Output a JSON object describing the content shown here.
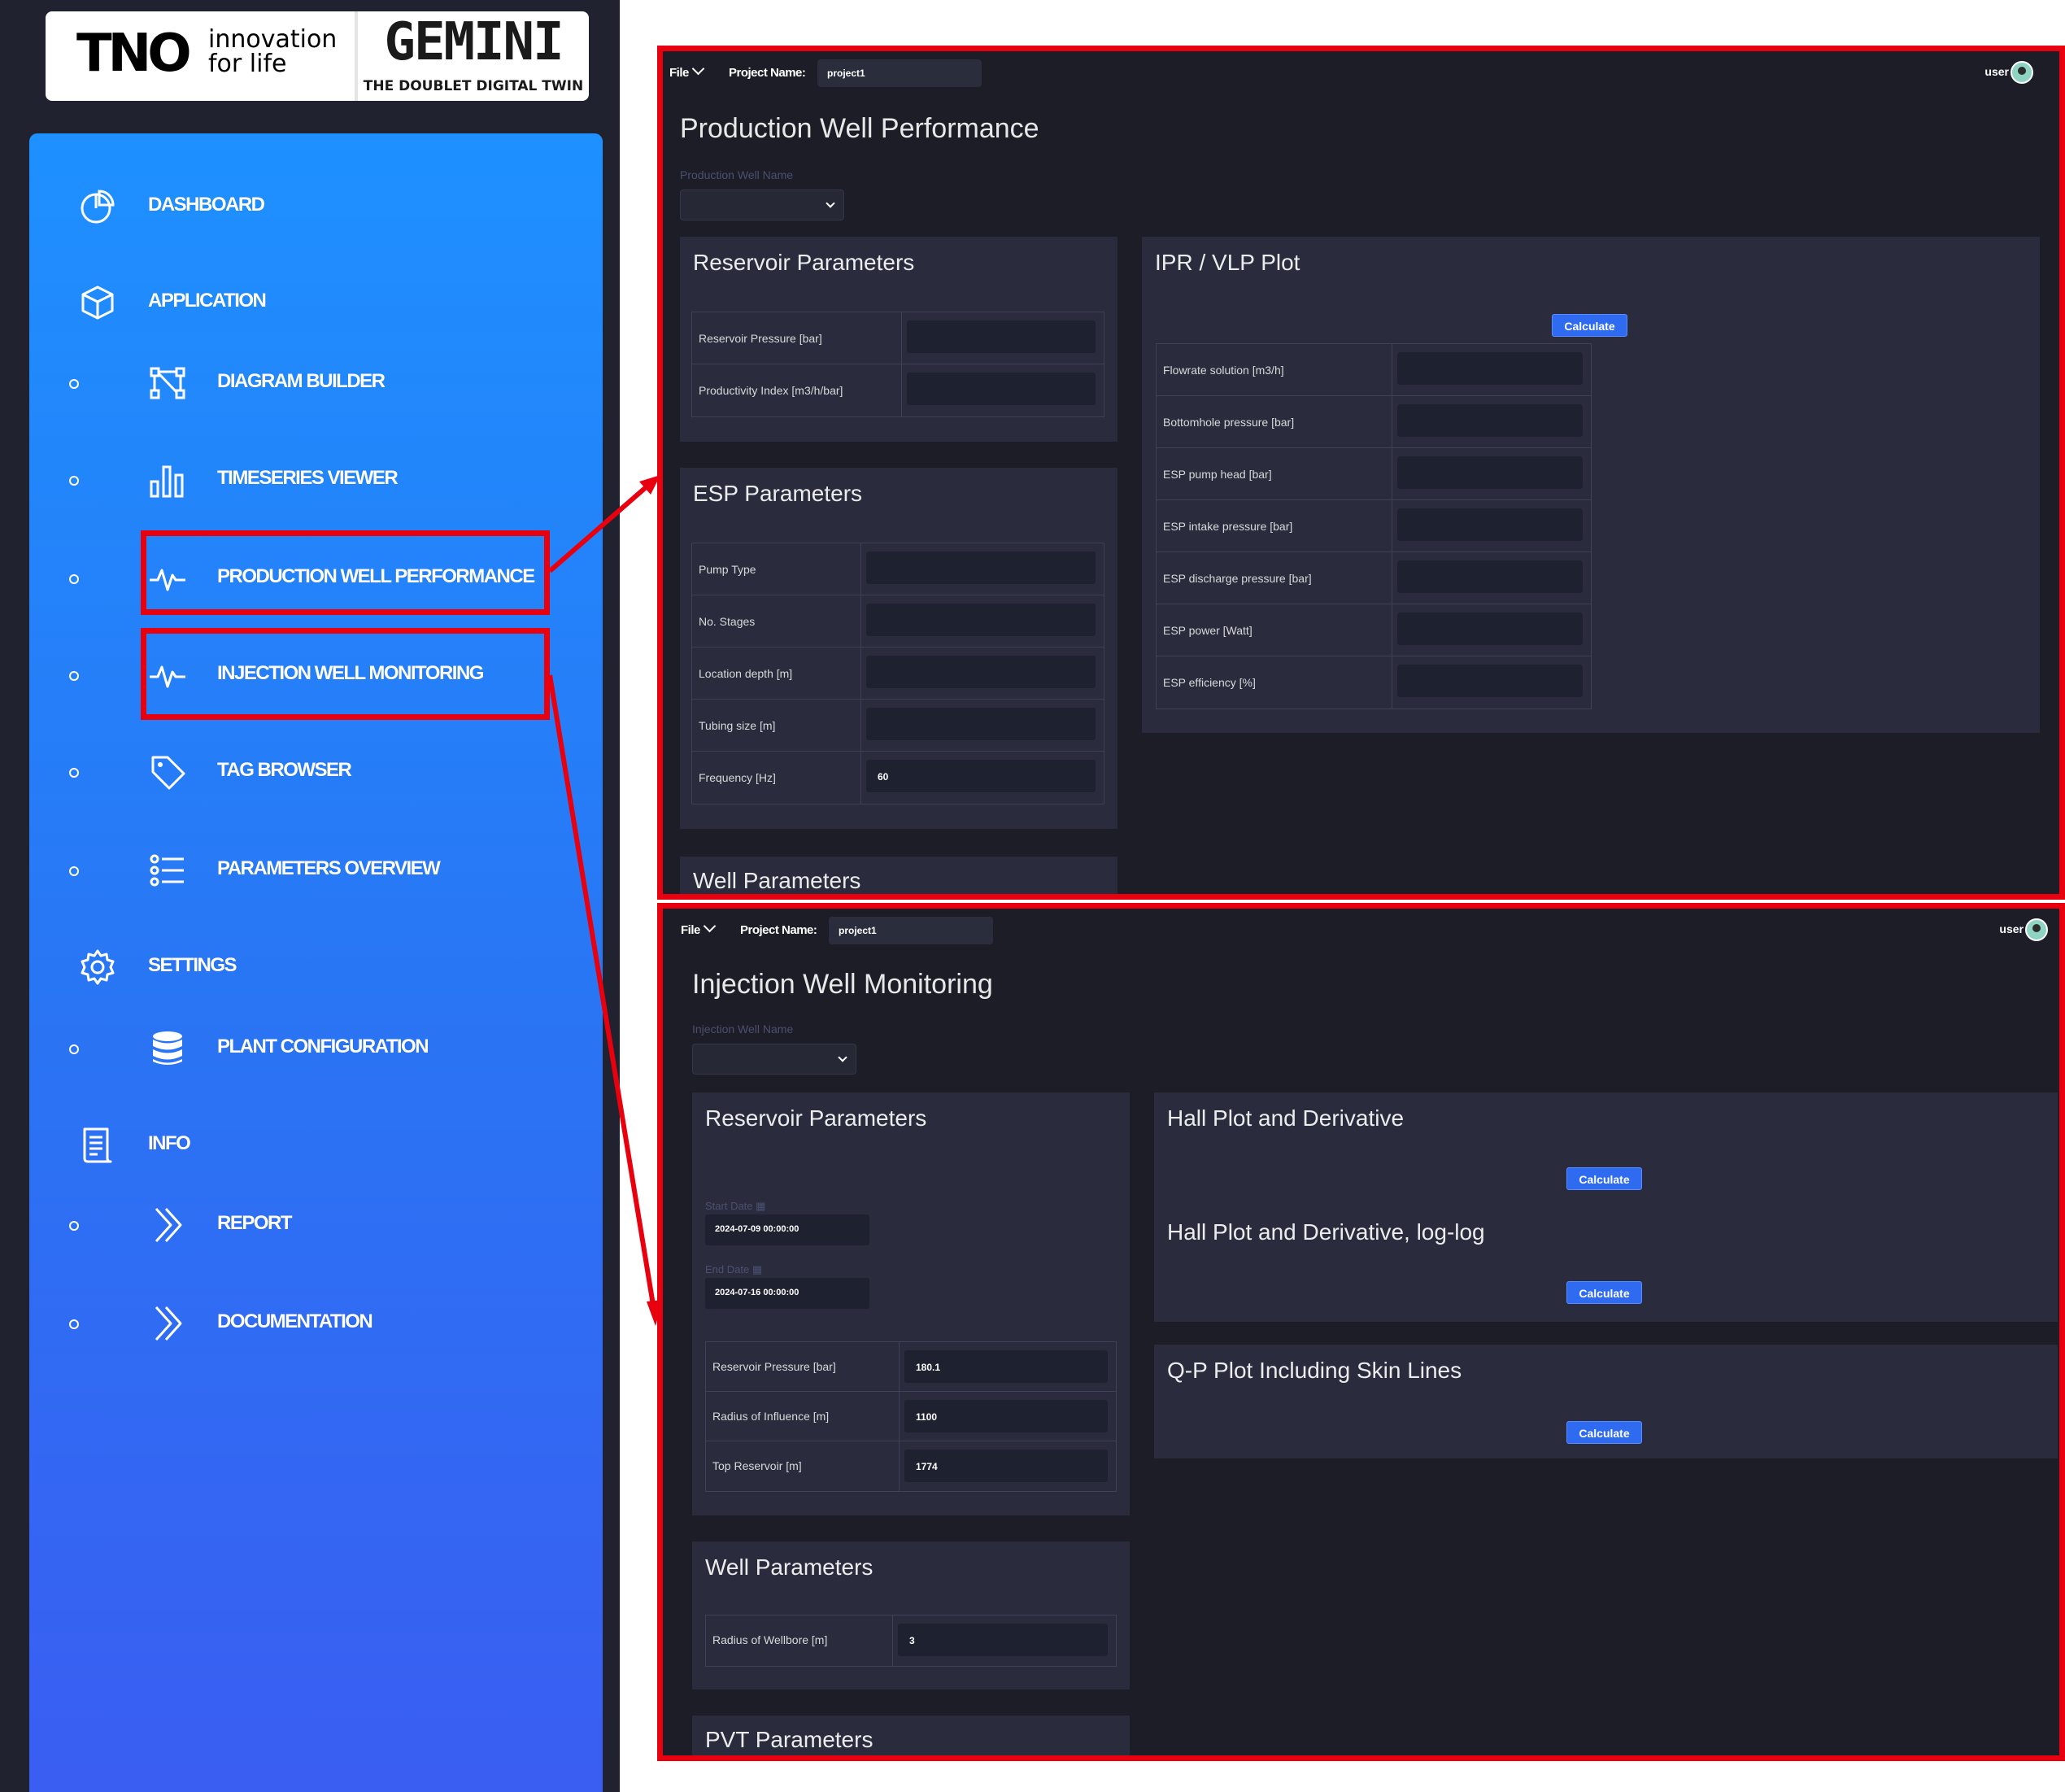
{
  "logos": {
    "tno_mark": "TNO",
    "tno_tagline_1": "innovation",
    "tno_tagline_2": "for life",
    "gemini_mark": "GEMINI",
    "gemini_subtitle": "THE DOUBLET DIGITAL TWIN"
  },
  "sidebar": {
    "items": [
      {
        "label": "DASHBOARD",
        "icon": "pie-chart-icon",
        "level": "top"
      },
      {
        "label": "APPLICATION",
        "icon": "cube-icon",
        "level": "top"
      },
      {
        "label": "DIAGRAM BUILDER",
        "icon": "diagram-icon",
        "level": "sub"
      },
      {
        "label": "TIMESERIES VIEWER",
        "icon": "bar-chart-icon",
        "level": "sub"
      },
      {
        "label": "PRODUCTION WELL PERFORMANCE",
        "icon": "pulse-icon",
        "level": "sub",
        "highlighted": true
      },
      {
        "label": "INJECTION WELL MONITORING",
        "icon": "pulse-icon",
        "level": "sub",
        "highlighted": true
      },
      {
        "label": "TAG BROWSER",
        "icon": "tag-icon",
        "level": "sub"
      },
      {
        "label": "PARAMETERS OVERVIEW",
        "icon": "list-icon",
        "level": "sub"
      },
      {
        "label": "SETTINGS",
        "icon": "gear-icon",
        "level": "top"
      },
      {
        "label": "PLANT CONFIGURATION",
        "icon": "database-icon",
        "level": "sub"
      },
      {
        "label": "INFO",
        "icon": "document-icon",
        "level": "top"
      },
      {
        "label": "REPORT",
        "icon": "double-chevron-icon",
        "level": "sub"
      },
      {
        "label": "DOCUMENTATION",
        "icon": "double-chevron-icon",
        "level": "sub"
      }
    ]
  },
  "colors": {
    "highlight": "#e8000e",
    "panel_top": "#1e90ff",
    "panel_bottom": "#3a5df2",
    "button": "#2f6bf0",
    "app_bg": "#1c1d27",
    "card_bg": "#2a2c3e"
  },
  "production": {
    "file_menu": "File",
    "project_label": "Project Name:",
    "project_value": "project1",
    "user": "user",
    "title": "Production Well Performance",
    "well_label": "Production Well Name",
    "reservoir": {
      "title": "Reservoir Parameters",
      "rows": [
        {
          "label": "Reservoir Pressure [bar]",
          "value": ""
        },
        {
          "label": "Productivity Index [m3/h/bar]",
          "value": ""
        }
      ]
    },
    "esp": {
      "title": "ESP Parameters",
      "rows": [
        {
          "label": "Pump Type",
          "value": ""
        },
        {
          "label": "No. Stages",
          "value": ""
        },
        {
          "label": "Location depth [m]",
          "value": ""
        },
        {
          "label": "Tubing size [m]",
          "value": ""
        },
        {
          "label": "Frequency [Hz]",
          "value": "60"
        }
      ]
    },
    "well": {
      "title": "Well Parameters"
    },
    "ipr": {
      "title": "IPR / VLP Plot",
      "button": "Calculate",
      "rows": [
        {
          "label": "Flowrate solution [m3/h]",
          "value": ""
        },
        {
          "label": "Bottomhole pressure [bar]",
          "value": ""
        },
        {
          "label": "ESP pump head [bar]",
          "value": ""
        },
        {
          "label": "ESP intake pressure [bar]",
          "value": ""
        },
        {
          "label": "ESP discharge pressure [bar]",
          "value": ""
        },
        {
          "label": "ESP power [Watt]",
          "value": ""
        },
        {
          "label": "ESP efficiency [%]",
          "value": ""
        }
      ]
    }
  },
  "injection": {
    "file_menu": "File",
    "project_label": "Project Name:",
    "project_value": "project1",
    "user": "user",
    "title": "Injection Well Monitoring",
    "well_label": "Injection Well Name",
    "reservoir": {
      "title": "Reservoir Parameters",
      "start_label": "Start Date",
      "start_value": "2024-07-09 00:00:00",
      "end_label": "End Date",
      "end_value": "2024-07-16 00:00:00",
      "rows": [
        {
          "label": "Reservoir Pressure [bar]",
          "value": "180.1"
        },
        {
          "label": "Radius of Influence [m]",
          "value": "1100"
        },
        {
          "label": "Top Reservoir [m]",
          "value": "1774"
        }
      ]
    },
    "well": {
      "title": "Well Parameters",
      "rows": [
        {
          "label": "Radius of Wellbore [m]",
          "value": "3"
        }
      ]
    },
    "pvt": {
      "title": "PVT Parameters"
    },
    "hall": {
      "title": "Hall Plot and Derivative",
      "button": "Calculate"
    },
    "hall_log": {
      "title": "Hall Plot and Derivative, log-log",
      "button": "Calculate"
    },
    "qp": {
      "title": "Q-P Plot Including Skin Lines",
      "button": "Calculate"
    }
  }
}
